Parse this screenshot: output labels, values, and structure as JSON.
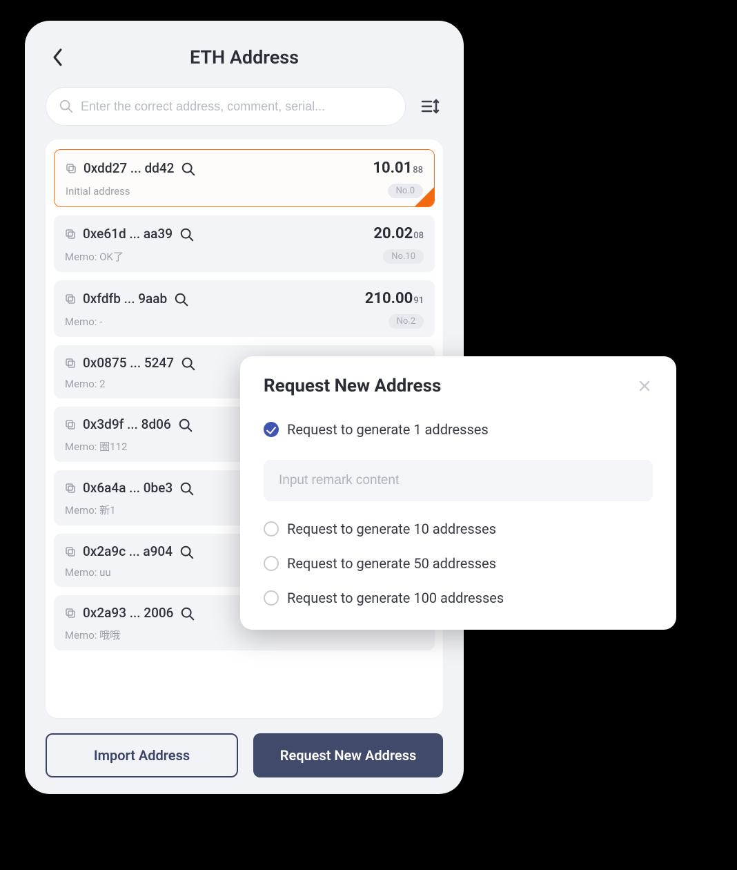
{
  "header": {
    "title": "ETH Address"
  },
  "search": {
    "placeholder": "Enter the correct address, comment, serial..."
  },
  "addresses": [
    {
      "addr": "0xdd27 ... dd42",
      "balance_main": "10.01",
      "balance_sub": "88",
      "memo": "Initial address",
      "seq": "No.0",
      "selected": true
    },
    {
      "addr": "0xe61d ... aa39",
      "balance_main": "20.02",
      "balance_sub": "08",
      "memo": "Memo: OK了",
      "seq": "No.10",
      "selected": false
    },
    {
      "addr": "0xfdfb ... 9aab",
      "balance_main": "210.00",
      "balance_sub": "91",
      "memo": "Memo: -",
      "seq": "No.2",
      "selected": false
    },
    {
      "addr": "0x0875 ... 5247",
      "balance_main": "",
      "balance_sub": "",
      "memo": "Memo: 2",
      "seq": "",
      "selected": false
    },
    {
      "addr": "0x3d9f ... 8d06",
      "balance_main": "",
      "balance_sub": "",
      "memo": "Memo: 圈112",
      "seq": "",
      "selected": false
    },
    {
      "addr": "0x6a4a ... 0be3",
      "balance_main": "",
      "balance_sub": "",
      "memo": "Memo: 新1",
      "seq": "",
      "selected": false
    },
    {
      "addr": "0x2a9c ... a904",
      "balance_main": "",
      "balance_sub": "",
      "memo": "Memo: uu",
      "seq": "",
      "selected": false
    },
    {
      "addr": "0x2a93 ... 2006",
      "balance_main": "",
      "balance_sub": "",
      "memo": "Memo: 哦哦",
      "seq": "",
      "selected": false
    }
  ],
  "footer": {
    "import_label": "Import Address",
    "request_label": "Request New Address"
  },
  "modal": {
    "title": "Request New Address",
    "remark_placeholder": "Input remark content",
    "options": [
      {
        "label": "Request to generate 1 addresses",
        "checked": true,
        "has_remark": true
      },
      {
        "label": "Request to generate 10 addresses",
        "checked": false,
        "has_remark": false
      },
      {
        "label": "Request to generate 50 addresses",
        "checked": false,
        "has_remark": false
      },
      {
        "label": "Request to generate 100 addresses",
        "checked": false,
        "has_remark": false
      }
    ]
  }
}
